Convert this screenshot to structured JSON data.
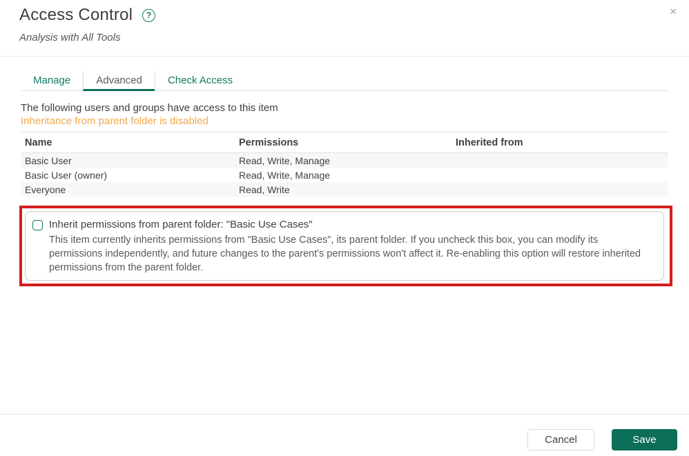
{
  "colors": {
    "accent_green": "#0f7a64",
    "save_green": "#0b6e56",
    "notice_orange": "#f2a84d",
    "annotation_red": "#d21e1e",
    "text_primary": "#404040",
    "text_secondary": "#595959",
    "row_alt_bg": "#f7f7f7"
  },
  "header": {
    "title": "Access Control",
    "subtitle": "Analysis with All Tools",
    "help_icon": "?",
    "close_icon": "×"
  },
  "tabs": [
    {
      "label": "Manage",
      "active": false
    },
    {
      "label": "Advanced",
      "active": true
    },
    {
      "label": "Check Access",
      "active": false
    }
  ],
  "content": {
    "intro": "The following users and groups have access to this item",
    "inheritance_notice": "Inheritance from parent folder is disabled"
  },
  "table": {
    "columns": [
      "Name",
      "Permissions",
      "Inherited from"
    ],
    "rows": [
      {
        "name": "Basic User",
        "permissions": "Read, Write, Manage",
        "inherited_from": ""
      },
      {
        "name": "Basic User (owner)",
        "permissions": "Read, Write, Manage",
        "inherited_from": ""
      },
      {
        "name": "Everyone",
        "permissions": "Read, Write",
        "inherited_from": ""
      }
    ]
  },
  "inherit_section": {
    "checkbox_checked": false,
    "label": "Inherit permissions from parent folder: \"Basic Use Cases\"",
    "description": "This item currently inherits permissions from \"Basic Use Cases\", its parent folder. If you uncheck this box, you can modify its permissions independently, and future changes to the parent's permissions won't affect it. Re-enabling this option will restore inherited permissions from the parent folder."
  },
  "footer": {
    "cancel_label": "Cancel",
    "save_label": "Save"
  }
}
